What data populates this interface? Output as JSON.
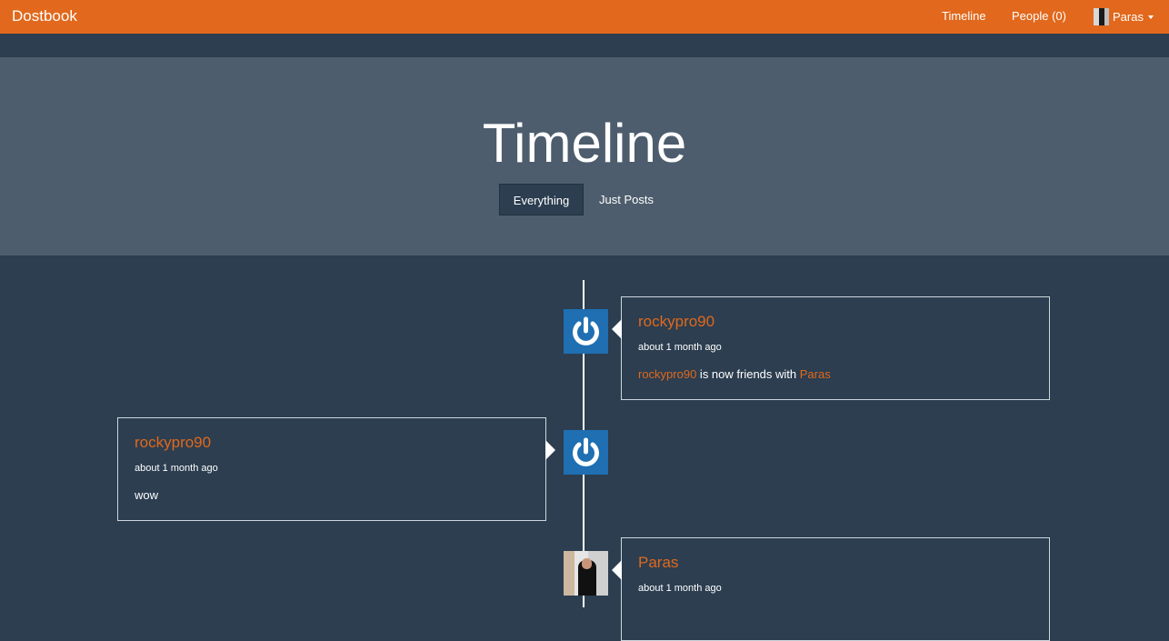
{
  "navbar": {
    "brand": "Dostbook",
    "links": [
      {
        "label": "Timeline"
      },
      {
        "label": "People (0)"
      }
    ],
    "user": {
      "name": "Paras"
    }
  },
  "header": {
    "title": "Timeline",
    "filters": [
      {
        "label": "Everything",
        "active": true
      },
      {
        "label": "Just Posts",
        "active": false
      }
    ]
  },
  "timeline": {
    "items": [
      {
        "author": "rockypro90",
        "time": "about 1 month ago",
        "body": {
          "actor": "rockypro90",
          "verb": " is now friends with ",
          "object": "Paras"
        },
        "avatar_icon": "power-icon",
        "side": "right"
      },
      {
        "author": "rockypro90",
        "time": "about 1 month ago",
        "body": {
          "text": "wow"
        },
        "avatar_icon": "power-icon",
        "side": "left"
      },
      {
        "author": "Paras",
        "time": "about 1 month ago",
        "avatar_icon": "user-photo",
        "side": "right"
      }
    ]
  },
  "colors": {
    "accent": "#e1681c",
    "background": "#2c3e50",
    "header_band": "#4d5d6d",
    "avatar_blue": "#1f6fb2"
  }
}
